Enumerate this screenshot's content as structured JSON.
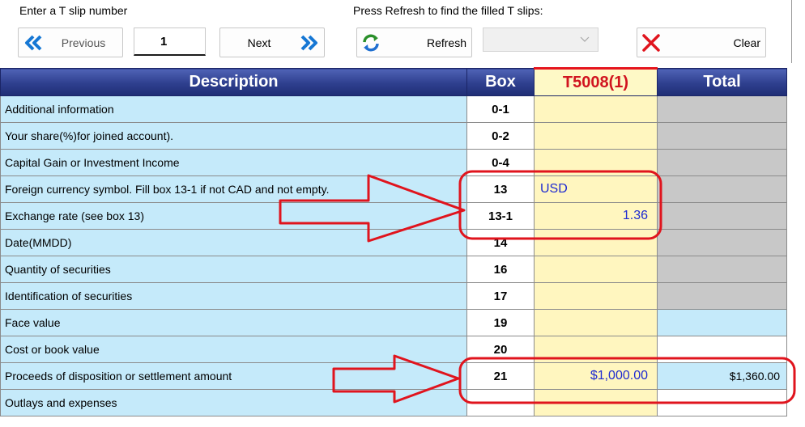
{
  "toolbar": {
    "slip_number_label": "Enter a T slip number",
    "refresh_hint": "Press Refresh to find the filled T slips:",
    "previous_label": "Previous",
    "slip_number_value": "1",
    "next_label": "Next",
    "refresh_label": "Refresh",
    "combo_value": "",
    "clear_label": "Clear"
  },
  "table": {
    "headers": {
      "description": "Description",
      "box": "Box",
      "slip": "T5008(1)",
      "total": "Total"
    },
    "rows": [
      {
        "description": "Additional information",
        "box": "0-1",
        "slip": "",
        "total": ""
      },
      {
        "description": "Your share(%)for joined account).",
        "box": "0-2",
        "slip": "",
        "total": ""
      },
      {
        "description": "Capital Gain or Investment Income",
        "box": "0-4",
        "slip": "",
        "total": ""
      },
      {
        "description": "Foreign currency symbol. Fill box 13-1 if not CAD and not empty.",
        "box": "13",
        "slip": "USD",
        "total": ""
      },
      {
        "description": "Exchange rate (see box 13)",
        "box": "13-1",
        "slip": "1.36",
        "total": ""
      },
      {
        "description": "Date(MMDD)",
        "box": "14",
        "slip": "",
        "total": ""
      },
      {
        "description": "Quantity of securities",
        "box": "16",
        "slip": "",
        "total": ""
      },
      {
        "description": "Identification of securities",
        "box": "17",
        "slip": "",
        "total": ""
      },
      {
        "description": "Face value",
        "box": "19",
        "slip": "",
        "total": ""
      },
      {
        "description": "Cost or book value",
        "box": "20",
        "slip": "",
        "total": ""
      },
      {
        "description": "Proceeds of disposition or settlement amount",
        "box": "21",
        "slip": "$1,000.00",
        "total": "$1,360.00"
      },
      {
        "description": "Outlays and expenses",
        "box": "",
        "slip": "",
        "total": ""
      }
    ]
  },
  "colors": {
    "header_blue": "#2e3f8e",
    "description_cell": "#c5eafa",
    "slip_cell": "#fff6bf",
    "slip_value_text": "#1f2bd1",
    "slip_header_text": "#d1141f",
    "total_disabled": "#c8c8c8",
    "annotation_red": "#e0141d"
  },
  "icons": {
    "previous": "double-chevron-left-icon",
    "next": "double-chevron-right-icon",
    "refresh": "refresh-arrows-icon",
    "clear": "red-x-icon",
    "combo": "chevron-down-icon"
  }
}
